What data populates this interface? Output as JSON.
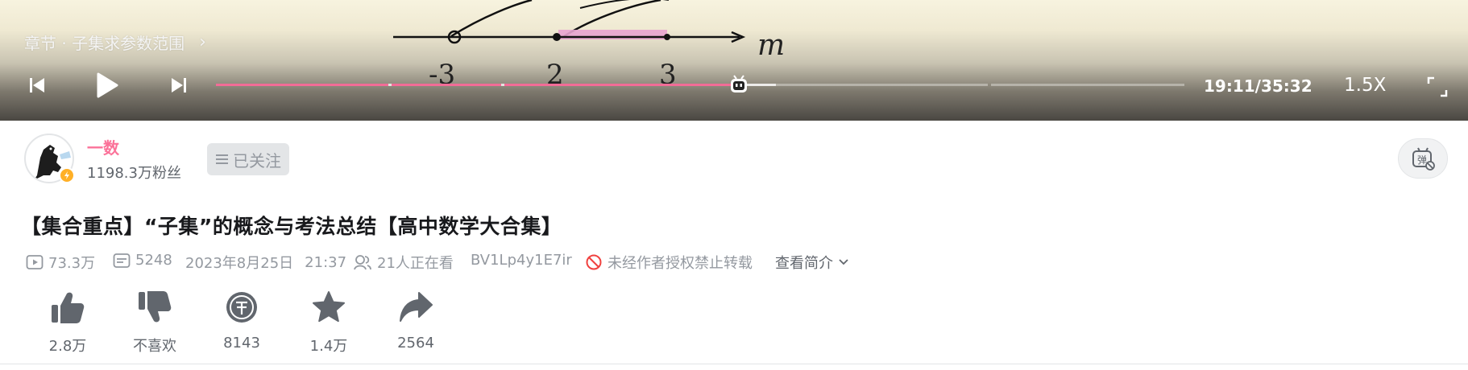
{
  "player": {
    "board": {
      "tick_labels": [
        "-3",
        "2",
        "3"
      ],
      "variable": "m"
    },
    "chapter": "章节 · 子集求参数范围",
    "time": "19:11/35:32",
    "speed": "1.5X",
    "progress_fraction": 0.54,
    "buffered_fraction": 0.578,
    "colors": {
      "progress": "#f26c97",
      "highlight": "#e8a3cf"
    },
    "icons": [
      "previous-icon",
      "play-icon",
      "next-icon",
      "fullscreen-icon",
      "tv-mascot-icon"
    ]
  },
  "uploader": {
    "name": "一数",
    "fans": "1198.3万粉丝",
    "follow_label": "已关注",
    "colors": {
      "name": "#fb7299"
    }
  },
  "video": {
    "title": "【集合重点】“子集”的概念与考法总结【高中数学大合集】",
    "views": "73.3万",
    "danmaku": "5248",
    "date": "2023年8月25日",
    "time": "21:37",
    "watching": "21人正在看",
    "bvid": "BV1Lp4y1E7ir",
    "copyright": "未经作者授权禁止转载",
    "intro_label": "查看简介"
  },
  "actions": {
    "like": "2.8万",
    "dislike": "不喜欢",
    "coin": "8143",
    "favorite": "1.4万",
    "share": "2564"
  }
}
